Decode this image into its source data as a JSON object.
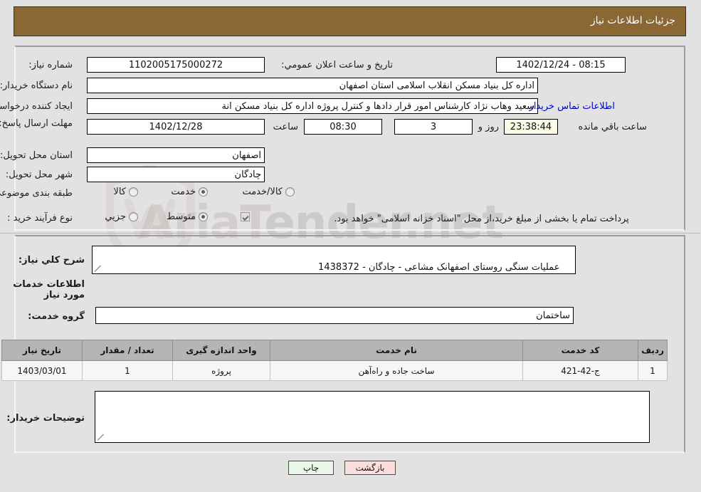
{
  "header": {
    "title": "جزئیات اطلاعات نیاز",
    "bar_color": "#8a6733"
  },
  "top_section": {
    "need_number_label": "شماره نیاز:",
    "need_number_value": "1102005175000272",
    "announce_label": "تاریخ و ساعت اعلان عمومي:",
    "announce_value": "1402/12/24 - 08:15",
    "buyer_org_label": "نام دستگاه خریدار:",
    "buyer_org_value": "اداره کل بنیاد مسکن انقلاب اسلامی استان اصفهان",
    "requester_label": "ایجاد کننده درخواست:",
    "requester_value": "سعید وهاب نژاد کارشناس امور قرار دادها و کنترل  پروژه اداره کل بنیاد مسکن انة",
    "contact_link": "اطلاعات تماس خریدار",
    "deadline_label": "مهلت ارسال پاسخ: تا تاریخ:",
    "deadline_date": "1402/12/28",
    "deadline_time_label": "ساعت",
    "deadline_time": "08:30",
    "remaining_days": "3",
    "remaining_days_label": "روز و",
    "remaining_clock": "23:38:44",
    "remaining_clock_label": "ساعت باقي مانده",
    "province_label": "استان محل تحویل:",
    "province_value": "اصفهان",
    "city_label": "شهر محل تحویل:",
    "city_value": "چادگان",
    "category_label": "طبقه بندی موضوعی:",
    "category_options": [
      {
        "label": "کالا",
        "selected": false
      },
      {
        "label": "خدمت",
        "selected": true
      },
      {
        "label": "کالا/خدمت",
        "selected": false
      }
    ],
    "purchase_type_label": "نوع فرآیند خرید :",
    "purchase_type_options": [
      {
        "label": "جزیي",
        "selected": false
      },
      {
        "label": "متوسط",
        "selected": true
      }
    ],
    "treasury_note": "پرداخت تمام یا بخشی از مبلغ خرید،از محل \"اسناد خزانه اسلامی\" خواهد بود.",
    "treasury_checked": true
  },
  "bottom_section": {
    "general_desc_label": "شرح کلي نیاز:",
    "general_desc_value": "عملیات سنگی روستای اصفهانک مشاعی - چادگان - 1438372",
    "services_heading": "اطلاعات خدمات مورد نیاز",
    "service_group_label": "گروه خدمت:",
    "service_group_value": "ساختمان",
    "table": {
      "columns": [
        "ردیف",
        "کد خدمت",
        "نام خدمت",
        "واحد اندازه گیری",
        "تعداد / مقدار",
        "تاریخ نیاز"
      ],
      "rows": [
        [
          "1",
          "ج-42-421",
          "ساخت جاده و راه‌آهن",
          "پروژه",
          "1",
          "1403/03/01"
        ]
      ]
    },
    "buyer_notes_label": "توضیحات خریدار:",
    "buyer_notes_value": ""
  },
  "footer": {
    "print_label": "چاپ",
    "back_label": "بازگشت"
  },
  "watermark": {
    "text_left": "AriaT",
    "text_right": "ender.net"
  }
}
